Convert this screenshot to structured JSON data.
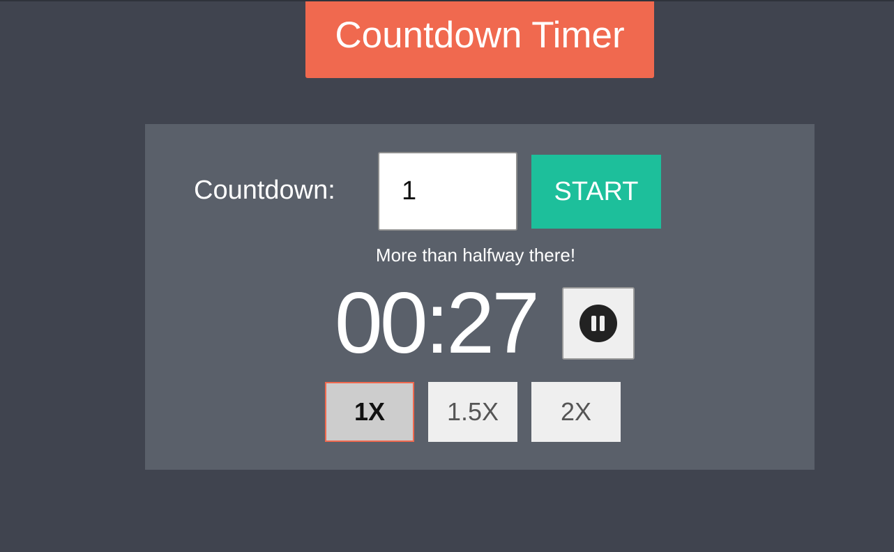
{
  "app": {
    "title": "Countdown Timer"
  },
  "colors": {
    "background": "#40444f",
    "title_banner": "#f0694f",
    "panel": "#5a606a",
    "start_button": "#1dbf9b",
    "active_speed_border": "#f0694f"
  },
  "countdown": {
    "label": "Countdown:",
    "input_value": "1",
    "start_label": "START"
  },
  "status": {
    "message": "More than halfway there!"
  },
  "timer": {
    "display": "00:27",
    "state": "running",
    "pause_icon": "pause-icon"
  },
  "speeds": {
    "options": [
      {
        "label": "1X",
        "active": true
      },
      {
        "label": "1.5X",
        "active": false
      },
      {
        "label": "2X",
        "active": false
      }
    ],
    "selected": "1X"
  }
}
